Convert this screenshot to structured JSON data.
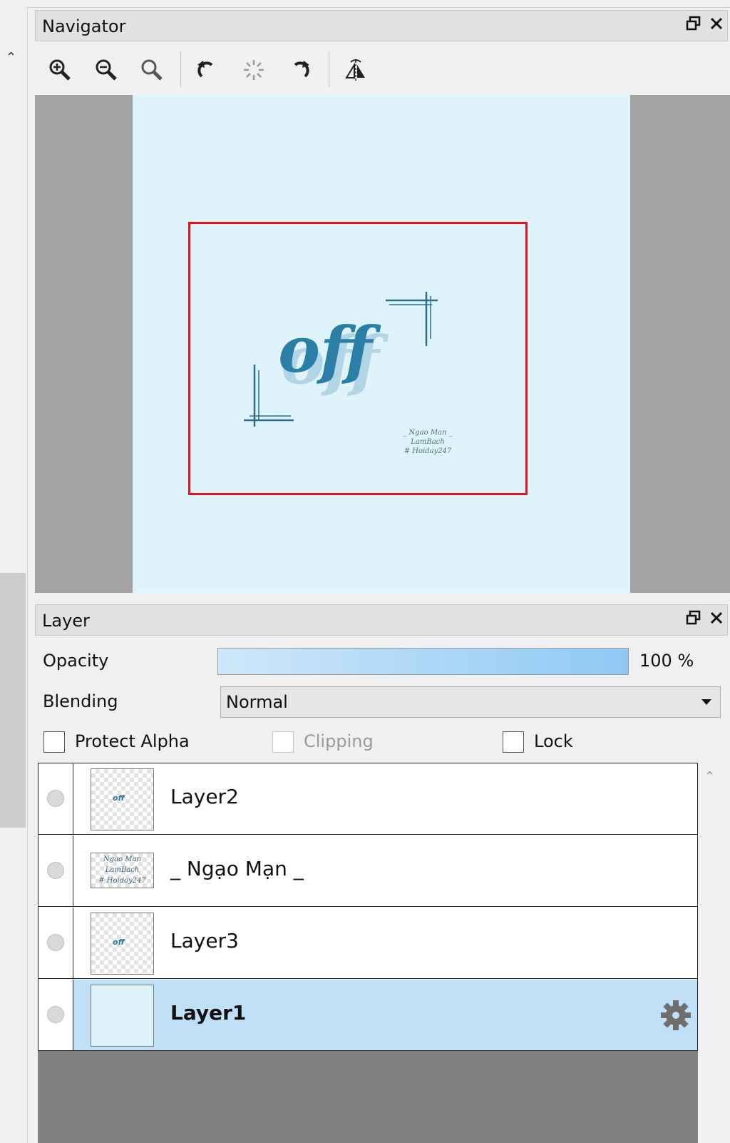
{
  "navigator": {
    "title": "Navigator",
    "toolbar": {
      "zoom_in": "zoom-in-icon",
      "zoom_out": "zoom-out-icon",
      "zoom_reset": "zoom-reset-icon",
      "rotate_left": "rotate-left-icon",
      "rotate_reset": "rotate-reset-icon",
      "rotate_right": "rotate-right-icon",
      "flip": "flip-horizontal-icon"
    },
    "artwork": {
      "word": "off",
      "credit_lines": [
        "_ Ngao Man _",
        "LamBach",
        "# Hoiday247"
      ]
    }
  },
  "layer_panel": {
    "title": "Layer",
    "opacity_label": "Opacity",
    "opacity_value": "100 %",
    "opacity_fraction": 1.0,
    "blending_label": "Blending",
    "blending_value": "Normal",
    "protect_alpha_label": "Protect Alpha",
    "clipping_label": "Clipping",
    "lock_label": "Lock",
    "layers": [
      {
        "name": "Layer2",
        "selected": false
      },
      {
        "name": "_ Ngạo Mạn _",
        "selected": false,
        "thumb_text": [
          "Ngao Man",
          "LamBach",
          "# Hoiday247"
        ]
      },
      {
        "name": "Layer3",
        "selected": false
      },
      {
        "name": "Layer1",
        "selected": true
      }
    ]
  },
  "colors": {
    "accent_selection": "#c0e0f7",
    "viewport_border": "#e0141a",
    "canvas_bg": "#dff3fb",
    "art_blue": "#2b7ea6"
  }
}
